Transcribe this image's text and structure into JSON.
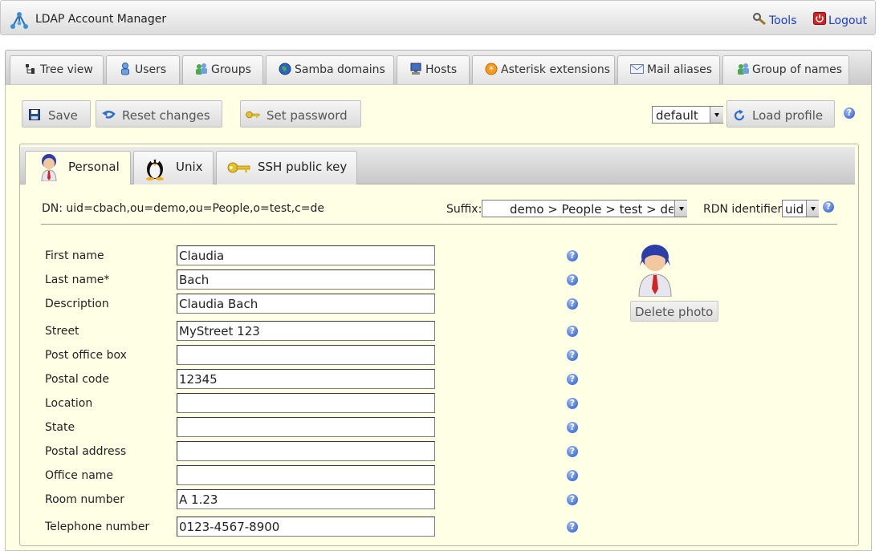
{
  "header": {
    "app_title": "LDAP Account Manager",
    "tools_label": "Tools",
    "logout_label": "Logout"
  },
  "main_tabs": [
    {
      "label": "Tree view",
      "icon": "tree-icon"
    },
    {
      "label": "Users",
      "icon": "user-icon"
    },
    {
      "label": "Groups",
      "icon": "group-icon"
    },
    {
      "label": "Samba domains",
      "icon": "globe-icon"
    },
    {
      "label": "Hosts",
      "icon": "computer-icon"
    },
    {
      "label": "Asterisk extensions",
      "icon": "asterisk-icon"
    },
    {
      "label": "Mail aliases",
      "icon": "mail-icon"
    },
    {
      "label": "Group of names",
      "icon": "group-icon"
    }
  ],
  "toolbar": {
    "save_label": "Save",
    "reset_label": "Reset changes",
    "set_password_label": "Set password",
    "profile_selected": "default",
    "load_profile_label": "Load profile"
  },
  "sub_tabs": [
    {
      "label": "Personal",
      "icon": "person-icon"
    },
    {
      "label": "Unix",
      "icon": "penguin-icon"
    },
    {
      "label": "SSH public key",
      "icon": "key-icon"
    }
  ],
  "account": {
    "dn_label": "DN: uid=cbach,ou=demo,ou=People,o=test,c=de",
    "suffix_label": "Suffix:",
    "suffix_value": "demo > People > test > de",
    "rdn_label": "RDN identifier:",
    "rdn_value": "uid"
  },
  "fields": [
    {
      "label": "First name",
      "value": "Claudia"
    },
    {
      "label": "Last name*",
      "value": "Bach"
    },
    {
      "label": "Description",
      "value": "Claudia Bach"
    },
    {
      "label": "Street",
      "value": "MyStreet 123"
    },
    {
      "label": "Post office box",
      "value": ""
    },
    {
      "label": "Postal code",
      "value": "12345"
    },
    {
      "label": "Location",
      "value": ""
    },
    {
      "label": "State",
      "value": ""
    },
    {
      "label": "Postal address",
      "value": ""
    },
    {
      "label": "Office name",
      "value": ""
    },
    {
      "label": "Room number",
      "value": "A 1.23"
    },
    {
      "label": "Telephone number",
      "value": "0123-4567-8900"
    }
  ],
  "photo": {
    "delete_label": "Delete photo"
  },
  "help_glyph": "?"
}
